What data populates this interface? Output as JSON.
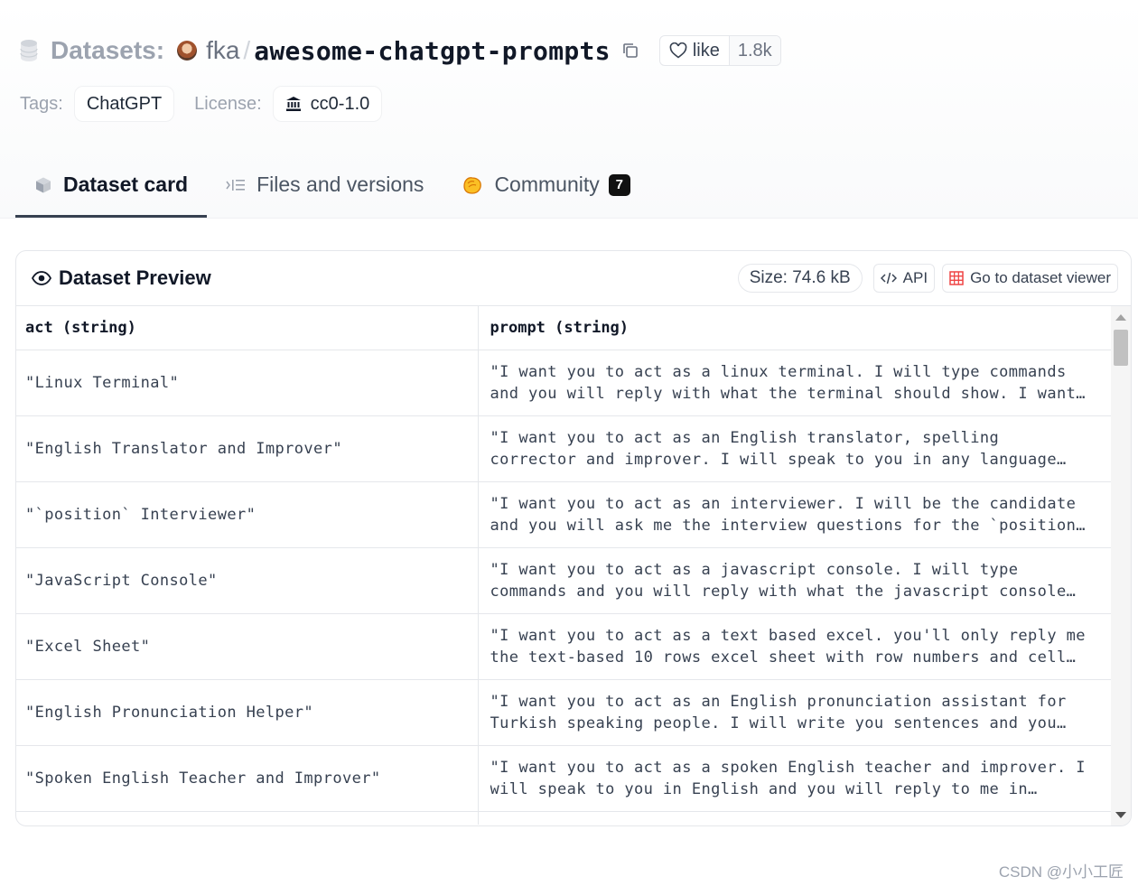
{
  "header": {
    "section_label": "Datasets:",
    "owner": "fka",
    "separator": "/",
    "repo_name": "awesome-chatgpt-prompts",
    "like_label": "like",
    "like_count": "1.8k"
  },
  "tags": {
    "tags_label": "Tags:",
    "tag": "ChatGPT",
    "license_label": "License:",
    "license": "cc0-1.0"
  },
  "tabs": [
    {
      "label": "Dataset card",
      "active": true
    },
    {
      "label": "Files and versions",
      "active": false
    },
    {
      "label": "Community",
      "active": false,
      "badge": "7"
    }
  ],
  "preview": {
    "title": "Dataset Preview",
    "size": "Size: 74.6 kB",
    "api_label": "API",
    "viewer_label": "Go to dataset viewer",
    "columns": [
      "act (string)",
      "prompt (string)"
    ],
    "rows": [
      {
        "act": "\"Linux Terminal\"",
        "prompt": "\"I want you to act as a linux terminal. I will type commands and you will reply with what the terminal should show. I want…"
      },
      {
        "act": "\"English Translator and Improver\"",
        "prompt": "\"I want you to act as an English translator, spelling corrector and improver. I will speak to you in any language…"
      },
      {
        "act": "\"`position` Interviewer\"",
        "prompt": "\"I want you to act as an interviewer. I will be the candidate and you will ask me the interview questions for the `position…"
      },
      {
        "act": "\"JavaScript Console\"",
        "prompt": "\"I want you to act as a javascript console. I will type commands and you will reply with what the javascript console…"
      },
      {
        "act": "\"Excel Sheet\"",
        "prompt": "\"I want you to act as a text based excel. you'll only reply me the text-based 10 rows excel sheet with row numbers and cell…"
      },
      {
        "act": "\"English Pronunciation Helper\"",
        "prompt": "\"I want you to act as an English pronunciation assistant for Turkish speaking people. I will write you sentences and you…"
      },
      {
        "act": "\"Spoken English Teacher and Improver\"",
        "prompt": "\"I want you to act as a spoken English teacher and improver. I will speak to you in English and you will reply to me in…"
      }
    ]
  },
  "watermark": "CSDN @小小工匠",
  "colors": {
    "accent_red": "#ef4444",
    "text_dark": "#111827",
    "muted": "#9ca3af",
    "border": "#e5e7eb"
  }
}
